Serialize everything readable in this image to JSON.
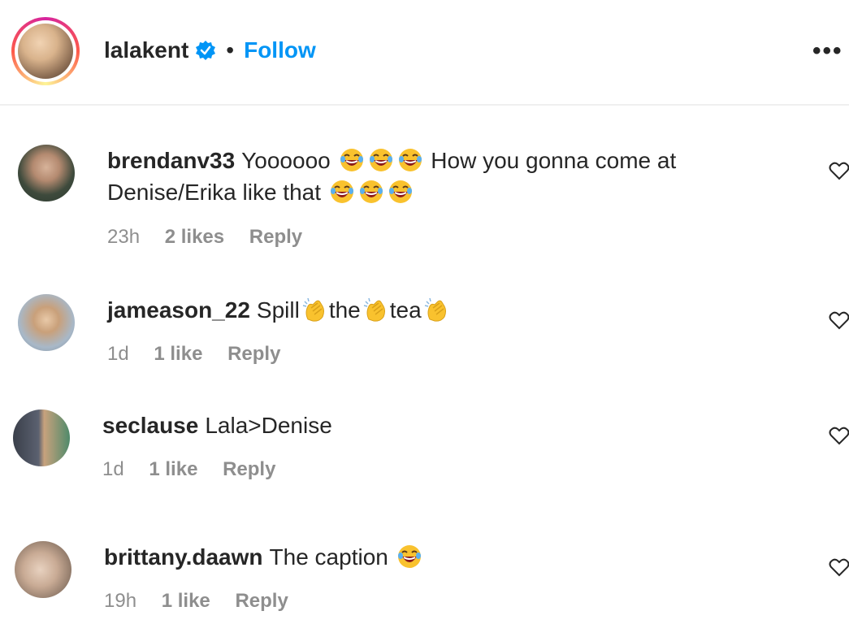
{
  "header": {
    "username": "lalakent",
    "separator": "•",
    "follow_label": "Follow",
    "more_label": "•••",
    "verified_icon": "verified-badge-icon",
    "colors": {
      "follow": "#0095f6",
      "verified": "#0095f6"
    }
  },
  "comments": [
    {
      "username": "brendanv33",
      "text_1": "Yoooooo",
      "text_2": "How you gonna come at Denise/Erika like that",
      "emoji_1": "face-with-tears-of-joy",
      "emoji_2": "face-with-tears-of-joy",
      "time": "23h",
      "likes": "2 likes",
      "reply": "Reply"
    },
    {
      "username": "jameason_22",
      "text_1": "Spill",
      "text_2": "the",
      "text_3": "tea",
      "emoji": "clapping-hands",
      "time": "1d",
      "likes": "1 like",
      "reply": "Reply"
    },
    {
      "username": "seclause",
      "text": "Lala>Denise",
      "time": "1d",
      "likes": "1 like",
      "reply": "Reply"
    },
    {
      "username": "brittany.daawn",
      "text": "The caption",
      "emoji": "face-with-tears-of-joy",
      "time": "19h",
      "likes": "1 like",
      "reply": "Reply"
    }
  ],
  "colors": {
    "text": "#262626",
    "meta": "#8e8e8e",
    "divider": "#efefef",
    "emoji_face": "#f9c22e",
    "emoji_mouth": "#c0392b"
  }
}
